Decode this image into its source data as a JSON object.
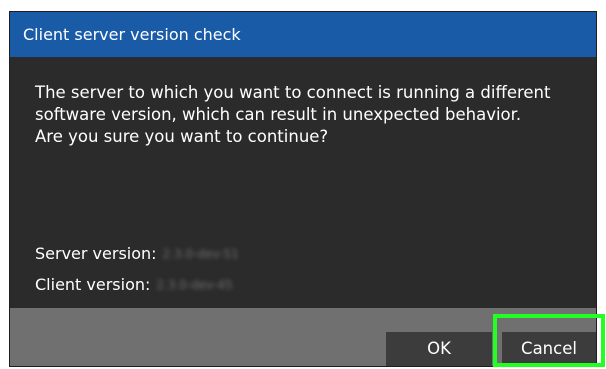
{
  "dialog": {
    "title": "Client server version check",
    "message_lines": [
      "The server to which you want to connect is running a different",
      "software version, which can result in unexpected behavior.",
      "Are you sure you want to continue?"
    ],
    "server_version_label": "Server version:",
    "server_version_value": "2.3.0-dev-51",
    "client_version_label": "Client version:",
    "client_version_value": "2.3.0-dev-45",
    "ok_label": "OK",
    "cancel_label": "Cancel"
  },
  "colors": {
    "titlebar": "#1a5ba8",
    "body": "#2b2b2b",
    "footer": "#707070",
    "button": "#3c3c3c",
    "highlight": "#22ff22"
  }
}
